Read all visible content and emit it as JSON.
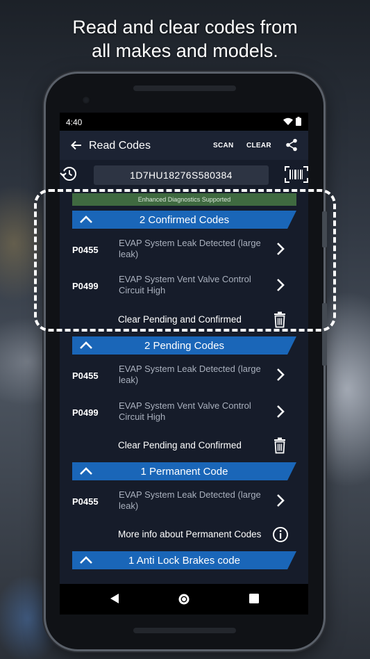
{
  "headline": {
    "line1": "Read and clear codes from",
    "line2": "all makes and models."
  },
  "status_bar": {
    "time": "4:40",
    "icons": [
      "wifi-icon",
      "battery-icon"
    ]
  },
  "app_bar": {
    "back_icon": "arrow-left-icon",
    "title": "Read Codes",
    "scan_label": "SCAN",
    "clear_label": "CLEAR",
    "share_icon": "share-icon"
  },
  "vin_row": {
    "history_icon": "history-icon",
    "vin": "1D7HU18276S580384",
    "barcode_icon": "barcode-scan-icon"
  },
  "enhanced_banner": "Enhanced Diagnostics Supported",
  "sections": {
    "confirmed": {
      "title": "2 Confirmed Codes",
      "rows": [
        {
          "code": "P0455",
          "desc_line1": "EVAP System Leak Detected (large",
          "desc_line2": "leak)"
        },
        {
          "code": "P0499",
          "desc_line1": "EVAP System Vent Valve Control",
          "desc_line2": "Circuit High"
        }
      ],
      "action": "Clear Pending and Confirmed"
    },
    "pending": {
      "title": "2 Pending Codes",
      "rows": [
        {
          "code": "P0455",
          "desc_line1": "EVAP System Leak Detected (large",
          "desc_line2": "leak)"
        },
        {
          "code": "P0499",
          "desc_line1": "EVAP System Vent Valve Control",
          "desc_line2": "Circuit High"
        }
      ],
      "action": "Clear Pending and Confirmed"
    },
    "permanent": {
      "title": "1 Permanent Code",
      "rows": [
        {
          "code": "P0455",
          "desc_line1": "EVAP System Leak Detected (large",
          "desc_line2": "leak)"
        }
      ],
      "action": "More info about Permanent Codes"
    },
    "abs": {
      "title": "1 Anti Lock Brakes code"
    }
  },
  "colors": {
    "section_header": "#1a66b8",
    "enhanced_banner": "#3f6a40",
    "screen_bg": "#161c2a"
  }
}
